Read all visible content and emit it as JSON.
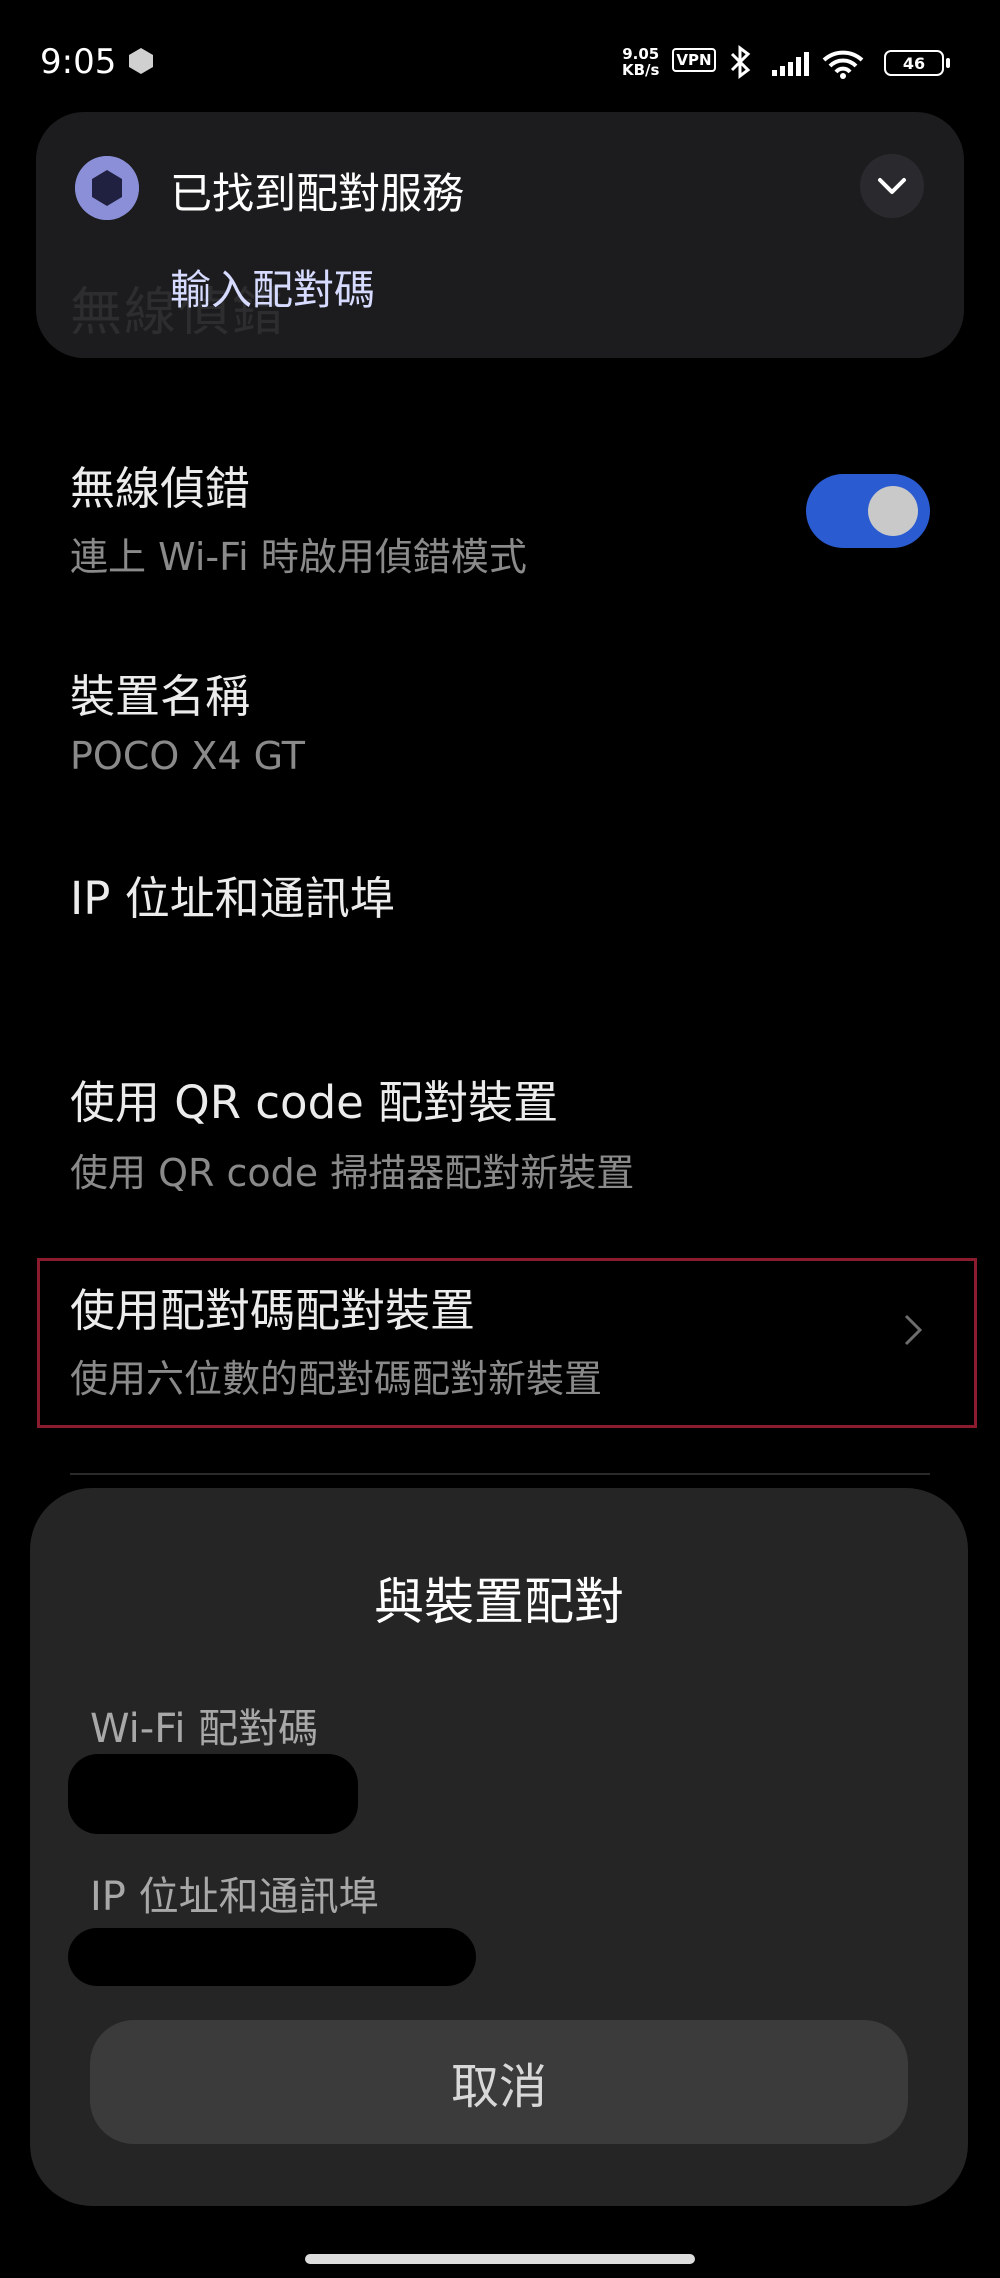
{
  "status_bar": {
    "time": "9:05",
    "speed_value": "9.05",
    "speed_unit": "KB/s",
    "vpn": "VPN",
    "battery": "46"
  },
  "notification": {
    "ghost_text": "無線偵錯",
    "title": "已找到配對服務",
    "action": "輸入配對碼"
  },
  "settings": {
    "wireless_debug": {
      "title": "無線偵錯",
      "subtitle": "連上 Wi-Fi 時啟用偵錯模式",
      "enabled": true
    },
    "device_name": {
      "title": "裝置名稱",
      "value": "POCO X4 GT"
    },
    "ip_port": {
      "title": "IP 位址和通訊埠"
    },
    "qr_pair": {
      "title": "使用 QR code 配對裝置",
      "subtitle": "使用 QR code 掃描器配對新裝置"
    },
    "code_pair": {
      "title": "使用配對碼配對裝置",
      "subtitle": "使用六位數的配對碼配對新裝置"
    }
  },
  "dialog": {
    "title": "與裝置配對",
    "wifi_code_label": "Wi-Fi 配對碼",
    "ip_label": "IP 位址和通訊埠",
    "cancel": "取消"
  },
  "colors": {
    "accent": "#2a5bd0",
    "highlight_border": "#8a1c2e",
    "dialog_bg": "#252525"
  }
}
